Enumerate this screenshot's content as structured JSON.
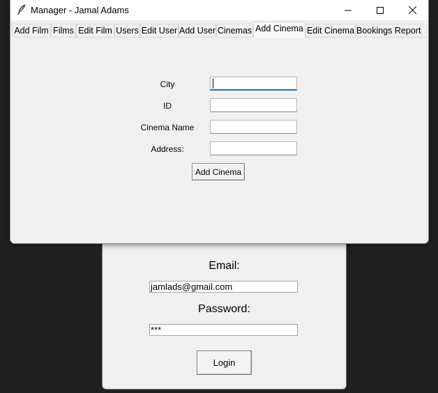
{
  "login_window": {
    "email_label": "Email:",
    "email_value": "jamlads@gmail.com",
    "password_label": "Password:",
    "password_value": "***",
    "login_label": "Login"
  },
  "window": {
    "title": "Manager - Jamal Adams",
    "icons": {
      "app": "feather-icon",
      "minimize": "minimize-icon",
      "maximize": "maximize-icon",
      "close": "close-icon"
    }
  },
  "tabs": [
    {
      "label": "Add Film"
    },
    {
      "label": "Films"
    },
    {
      "label": "Edit Film"
    },
    {
      "label": "Users"
    },
    {
      "label": "Edit User"
    },
    {
      "label": "Add User"
    },
    {
      "label": "Cinemas"
    },
    {
      "label": "Add Cinema",
      "active": true
    },
    {
      "label": "Edit Cinema"
    },
    {
      "label": "Bookings Report"
    }
  ],
  "form": {
    "city_label": "City",
    "city_value": "",
    "id_label": "ID",
    "id_value": "",
    "name_label": "Cinema Name",
    "name_value": "",
    "address_label": "Address:",
    "address_value": "",
    "submit_label": "Add Cinema"
  }
}
